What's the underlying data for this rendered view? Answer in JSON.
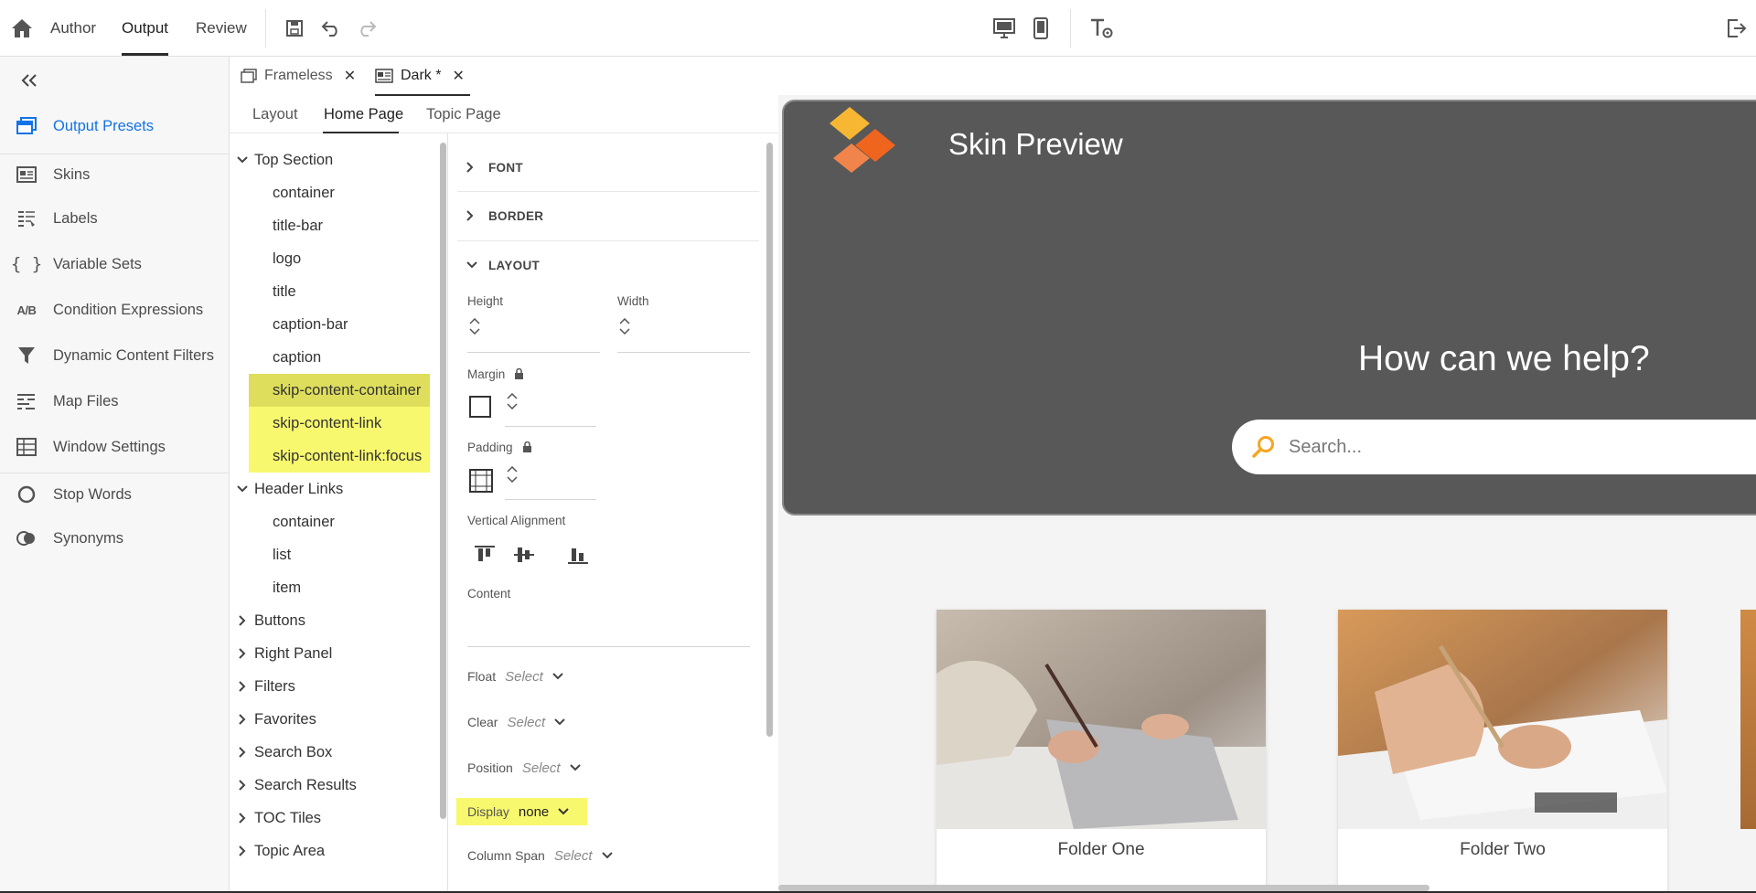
{
  "topbar": {
    "tabs": [
      "Author",
      "Output",
      "Review"
    ],
    "active_tab": "Output"
  },
  "filetabs": [
    {
      "label": "Frameless"
    },
    {
      "label": "Dark *"
    }
  ],
  "subtabs": [
    "Layout",
    "Home Page",
    "Topic Page"
  ],
  "leftnav": {
    "items": [
      {
        "label": "Output Presets",
        "icon": "presets-icon"
      },
      {
        "label": "Skins",
        "icon": "skins-icon"
      },
      {
        "label": "Labels",
        "icon": "labels-icon"
      },
      {
        "label": "Variable Sets",
        "icon": "braces-icon",
        "glyph": "{ }"
      },
      {
        "label": "Condition Expressions",
        "icon": "ab-icon",
        "glyph": "A/B"
      },
      {
        "label": "Dynamic Content Filters",
        "icon": "filter-icon"
      },
      {
        "label": "Map Files",
        "icon": "map-files-icon"
      },
      {
        "label": "Window Settings",
        "icon": "table-icon"
      },
      {
        "label": "Stop Words",
        "icon": "circle-icon"
      },
      {
        "label": "Synonyms",
        "icon": "synonyms-icon"
      }
    ]
  },
  "tree": {
    "top_section": "Top Section",
    "top_children": [
      "container",
      "title-bar",
      "logo",
      "title",
      "caption-bar",
      "caption",
      "skip-content-container",
      "skip-content-link",
      "skip-content-link:focus"
    ],
    "header_links": "Header Links",
    "header_children": [
      "container",
      "list",
      "item"
    ],
    "collapsed": [
      "Buttons",
      "Right Panel",
      "Filters",
      "Favorites",
      "Search Box",
      "Search Results",
      "TOC Tiles",
      "Topic Area"
    ]
  },
  "props": {
    "font": "FONT",
    "border": "BORDER",
    "layout": "LAYOUT",
    "height": "Height",
    "width": "Width",
    "margin": "Margin",
    "padding": "Padding",
    "vertical_alignment": "Vertical Alignment",
    "content": "Content",
    "float_label": "Float",
    "float_value": "Select",
    "clear_label": "Clear",
    "clear_value": "Select",
    "position_label": "Position",
    "position_value": "Select",
    "display_label": "Display",
    "display_value": "none",
    "column_span_label": "Column Span",
    "column_span_value": "Select"
  },
  "preview": {
    "title": "Skin Preview",
    "help": "How can we help?",
    "search_placeholder": "Search...",
    "cards": [
      "Folder One",
      "Folder Two"
    ]
  },
  "colors": {
    "accent": "#1473e6",
    "highlight": "#f8f86e",
    "hero": "#585858",
    "logo_orange": "#f0651e",
    "logo_yellow": "#f7b733"
  }
}
